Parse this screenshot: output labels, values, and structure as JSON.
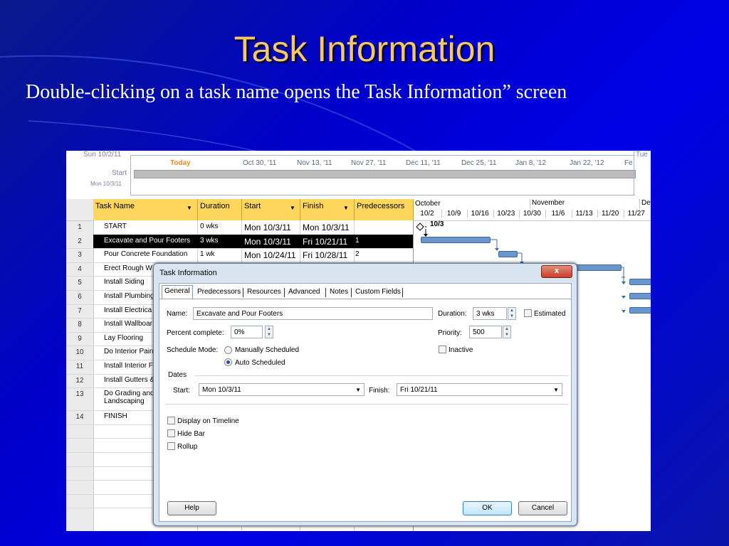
{
  "slide": {
    "title": "Task Information",
    "subtitle": "Double-clicking on a task name opens the Task Information” screen"
  },
  "timeline": {
    "start_date": "Sun 10/2/11",
    "today_label": "Today",
    "ticks": [
      "Oct 30, '11",
      "Nov 13, '11",
      "Nov 27, '11",
      "Dec 11, '11",
      "Dec 25, '11",
      "Jan 8, '12",
      "Jan 22, '12",
      "Fe"
    ],
    "start_label": "Start",
    "start_sub": "Mon 10/3/11",
    "end_label": "Tue"
  },
  "grid": {
    "columns": [
      "Task Name",
      "Duration",
      "Start",
      "Finish",
      "Predecessors"
    ],
    "rows": [
      {
        "num": "1",
        "name": "START",
        "dur": "0 wks",
        "start": "Mon 10/3/11",
        "finish": "Mon 10/3/11",
        "pred": ""
      },
      {
        "num": "2",
        "name": "Excavate and Pour Footers",
        "dur": "3 wks",
        "start": "Mon 10/3/11",
        "finish": "Fri 10/21/11",
        "pred": "1"
      },
      {
        "num": "3",
        "name": "Pour Concrete Foundation",
        "dur": "1 wk",
        "start": "Mon 10/24/11",
        "finish": "Fri 10/28/11",
        "pred": "2"
      },
      {
        "num": "4",
        "name": "Erect Rough W",
        "dur": "",
        "start": "",
        "finish": "",
        "pred": ""
      },
      {
        "num": "5",
        "name": "Install Siding",
        "dur": "",
        "start": "",
        "finish": "",
        "pred": ""
      },
      {
        "num": "6",
        "name": "Install Plumbing",
        "dur": "",
        "start": "",
        "finish": "",
        "pred": ""
      },
      {
        "num": "7",
        "name": "Install Electrica",
        "dur": "",
        "start": "",
        "finish": "",
        "pred": ""
      },
      {
        "num": "8",
        "name": "Install Wallboar",
        "dur": "",
        "start": "",
        "finish": "",
        "pred": ""
      },
      {
        "num": "9",
        "name": "Lay Flooring",
        "dur": "",
        "start": "",
        "finish": "",
        "pred": ""
      },
      {
        "num": "10",
        "name": "Do Interior Pain",
        "dur": "",
        "start": "",
        "finish": "",
        "pred": ""
      },
      {
        "num": "11",
        "name": "Install Interior F",
        "dur": "",
        "start": "",
        "finish": "",
        "pred": ""
      },
      {
        "num": "12",
        "name": "Install Gutters &",
        "dur": "",
        "start": "",
        "finish": "",
        "pred": ""
      },
      {
        "num": "13",
        "name": "Do Grading and\nLandscaping",
        "dur": "",
        "start": "",
        "finish": "",
        "pred": ""
      },
      {
        "num": "14",
        "name": "FINISH",
        "dur": "",
        "start": "",
        "finish": "",
        "pred": ""
      }
    ]
  },
  "gantt": {
    "months": [
      "October",
      "November",
      "De"
    ],
    "weeks": [
      "10/2",
      "10/9",
      "10/16",
      "10/23",
      "10/30",
      "11/6",
      "11/13",
      "11/20",
      "11/27"
    ],
    "milestone_label": "10/3"
  },
  "dialog": {
    "title": "Task Information",
    "close": "x",
    "tabs": [
      "General",
      "Predecessors",
      "Resources",
      "Advanced",
      "Notes",
      "Custom Fields"
    ],
    "name_label": "Name:",
    "name_value": "Excavate and Pour Footers",
    "duration_label": "Duration:",
    "duration_value": "3 wks",
    "estimated_label": "Estimated",
    "percent_label": "Percent complete:",
    "percent_value": "0%",
    "priority_label": "Priority:",
    "priority_value": "500",
    "schedule_mode_label": "Schedule Mode:",
    "manual_label": "Manually Scheduled",
    "auto_label": "Auto Scheduled",
    "inactive_label": "Inactive",
    "dates_label": "Dates",
    "start_label": "Start:",
    "start_value": "Mon 10/3/11",
    "finish_label": "Finish:",
    "finish_value": "Fri 10/21/11",
    "display_timeline_label": "Display on Timeline",
    "hide_bar_label": "Hide Bar",
    "rollup_label": "Rollup",
    "help_label": "Help",
    "ok_label": "OK",
    "cancel_label": "Cancel"
  }
}
